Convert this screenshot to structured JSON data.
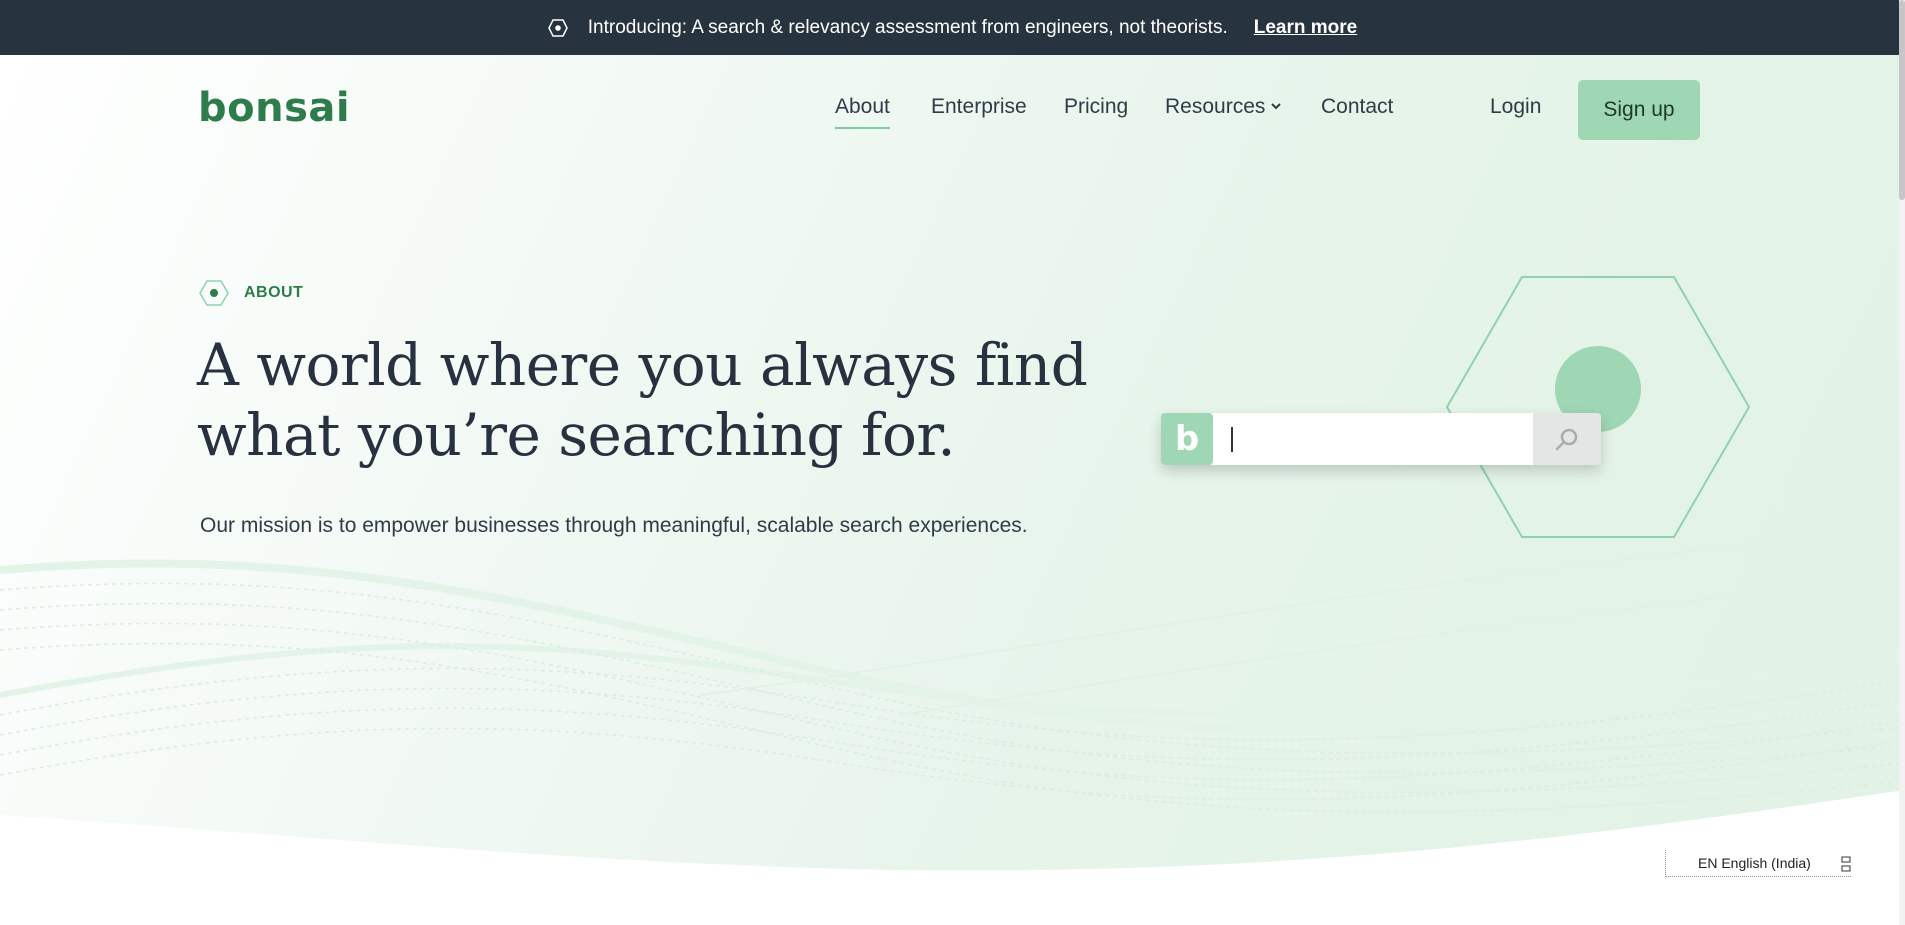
{
  "announcement": {
    "text": "Introducing: A search & relevancy assessment from engineers, not theorists.",
    "link_label": "Learn more",
    "icon": "hexagon-dot-icon"
  },
  "header": {
    "logo": "bonsai",
    "nav": [
      {
        "label": "About",
        "active": true
      },
      {
        "label": "Enterprise"
      },
      {
        "label": "Pricing"
      },
      {
        "label": "Resources",
        "has_dropdown": true
      },
      {
        "label": "Contact"
      }
    ],
    "login_label": "Login",
    "signup_label": "Sign up"
  },
  "hero": {
    "eyebrow": "ABOUT",
    "headline": "A world where you always find what you’re searching for.",
    "mission": "Our mission is to empower businesses through meaningful, scalable search experiences.",
    "search_badge": "b",
    "search_value": ""
  },
  "language_bar": {
    "label": "EN English (India)"
  },
  "colors": {
    "brand_green": "#2e7c4c",
    "mint": "#9fd6b3",
    "dark_navy": "#27333f",
    "hex_outline": "#8fd3ac"
  }
}
